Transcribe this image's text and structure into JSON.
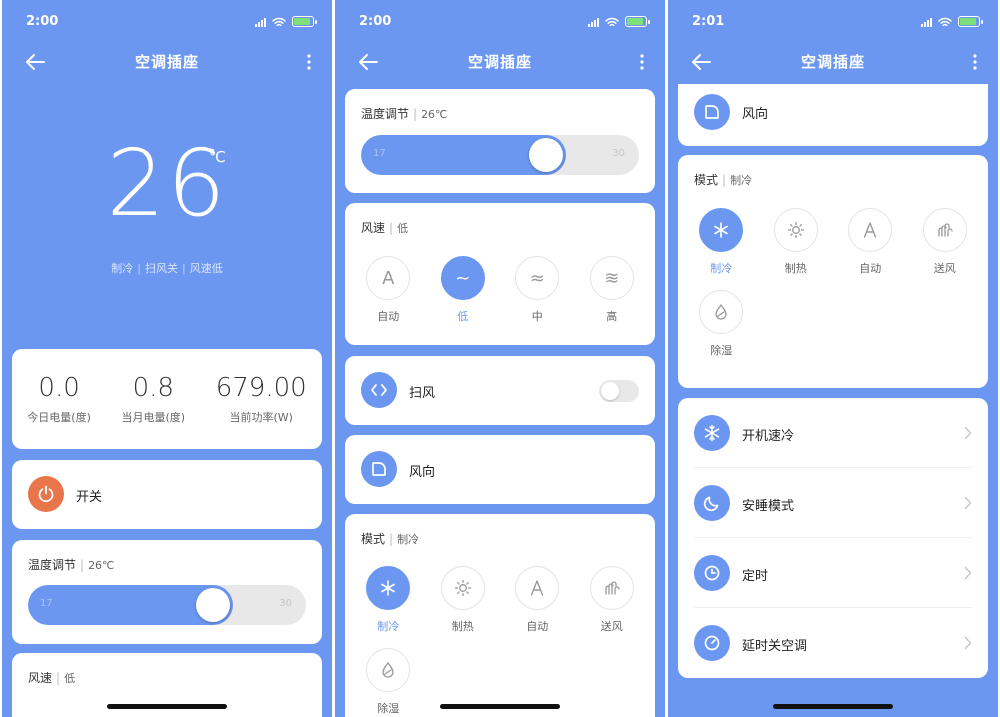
{
  "screens": [
    {
      "status": {
        "time": "2:00"
      },
      "nav": {
        "title": "空调插座"
      },
      "hero": {
        "temp": "26",
        "unit": "℃",
        "mode": "制冷",
        "swing": "扫风关",
        "speed": "风速低",
        "sep": "|"
      },
      "stats": [
        {
          "value": "0.0",
          "label": "今日电量(度)"
        },
        {
          "value": "0.8",
          "label": "当月电量(度)"
        },
        {
          "value": "679.00",
          "label": "当前功率(W)"
        }
      ],
      "power": {
        "label": "开关"
      },
      "temp_adjust": {
        "title": "温度调节",
        "value": "26℃",
        "min": "17",
        "max": "30",
        "level": 26
      },
      "fan": {
        "title": "风速",
        "value": "低"
      }
    },
    {
      "status": {
        "time": "2:00"
      },
      "nav": {
        "title": "空调插座"
      },
      "temp_adjust": {
        "title": "温度调节",
        "value": "26℃",
        "min": "17",
        "max": "30",
        "level": 26
      },
      "fan": {
        "title": "风速",
        "value": "低",
        "options": [
          {
            "glyph": "A",
            "label": "自动",
            "active": false
          },
          {
            "glyph": "~",
            "label": "低",
            "active": true
          },
          {
            "glyph": "≈",
            "label": "中",
            "active": false
          },
          {
            "glyph": "≋",
            "label": "高",
            "active": false
          }
        ]
      },
      "swing": {
        "label": "扫风",
        "on": false
      },
      "direction": {
        "label": "风向"
      },
      "mode": {
        "title": "模式",
        "value": "制冷",
        "options": [
          {
            "icon": "snowflake-icon",
            "label": "制冷",
            "active": true
          },
          {
            "icon": "sun-icon",
            "label": "制热",
            "active": false
          },
          {
            "icon": "auto-icon",
            "label": "自动",
            "active": false
          },
          {
            "icon": "fan-icon",
            "label": "送风",
            "active": false
          },
          {
            "icon": "droplet-icon",
            "label": "除湿",
            "active": false
          }
        ]
      }
    },
    {
      "status": {
        "time": "2:01"
      },
      "nav": {
        "title": "空调插座"
      },
      "direction": {
        "label": "风向"
      },
      "mode": {
        "title": "模式",
        "value": "制冷",
        "options": [
          {
            "icon": "snowflake-icon",
            "label": "制冷",
            "active": true
          },
          {
            "icon": "sun-icon",
            "label": "制热",
            "active": false
          },
          {
            "icon": "auto-icon",
            "label": "自动",
            "active": false
          },
          {
            "icon": "fan-icon",
            "label": "送风",
            "active": false
          },
          {
            "icon": "droplet-icon",
            "label": "除湿",
            "active": false
          }
        ]
      },
      "menu": [
        {
          "icon": "snowflake-icon",
          "label": "开机速冷"
        },
        {
          "icon": "moon-icon",
          "label": "安睡模式"
        },
        {
          "icon": "clock-icon",
          "label": "定时"
        },
        {
          "icon": "timer-icon",
          "label": "延时关空调"
        }
      ]
    }
  ],
  "colors": {
    "accent": "#6b97f1",
    "power": "#e8764a",
    "card": "#ffffff"
  }
}
